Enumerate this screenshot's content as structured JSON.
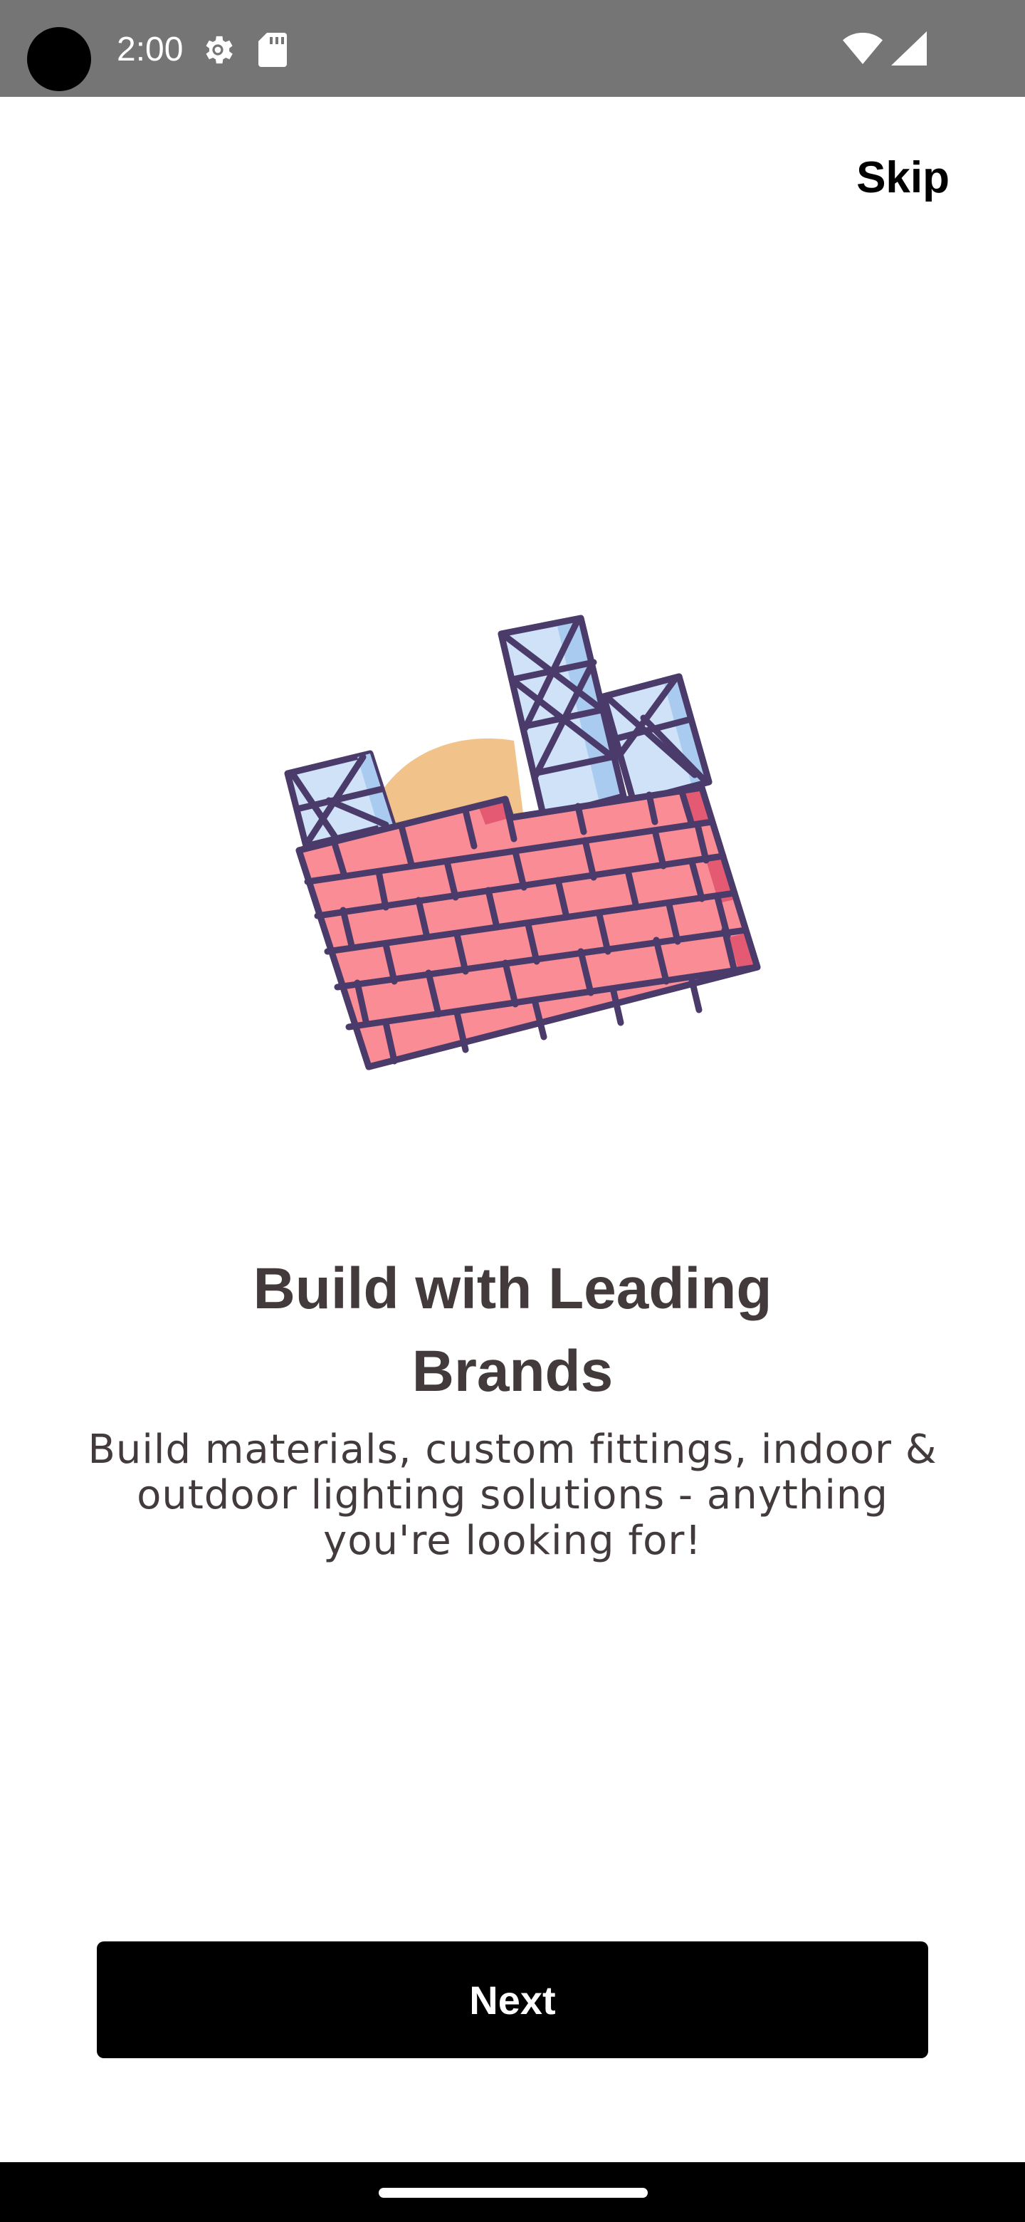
{
  "status_bar": {
    "time": "2:00",
    "icons": [
      "camera-cutout",
      "settings-gear-icon",
      "sd-card-icon",
      "wifi-icon",
      "cellular-signal-icon"
    ]
  },
  "onboarding": {
    "skip_label": "Skip",
    "illustration": "brick-wall-skyscraper-illustration",
    "title": "Build with Leading Brands",
    "subtitle": "Build materials, custom fittings, indoor & outdoor lighting solutions - anything you're looking for!",
    "next_label": "Next"
  },
  "colors": {
    "status_bar": "#757575",
    "title_text": "#433a3c",
    "button_bg": "#000000",
    "brick": "#f98c95",
    "brick_dark": "#e35a72",
    "outline": "#4b3b6b",
    "glass": "#cfe2f7",
    "glass_dark": "#a9cbef",
    "sun": "#f1c38b"
  }
}
